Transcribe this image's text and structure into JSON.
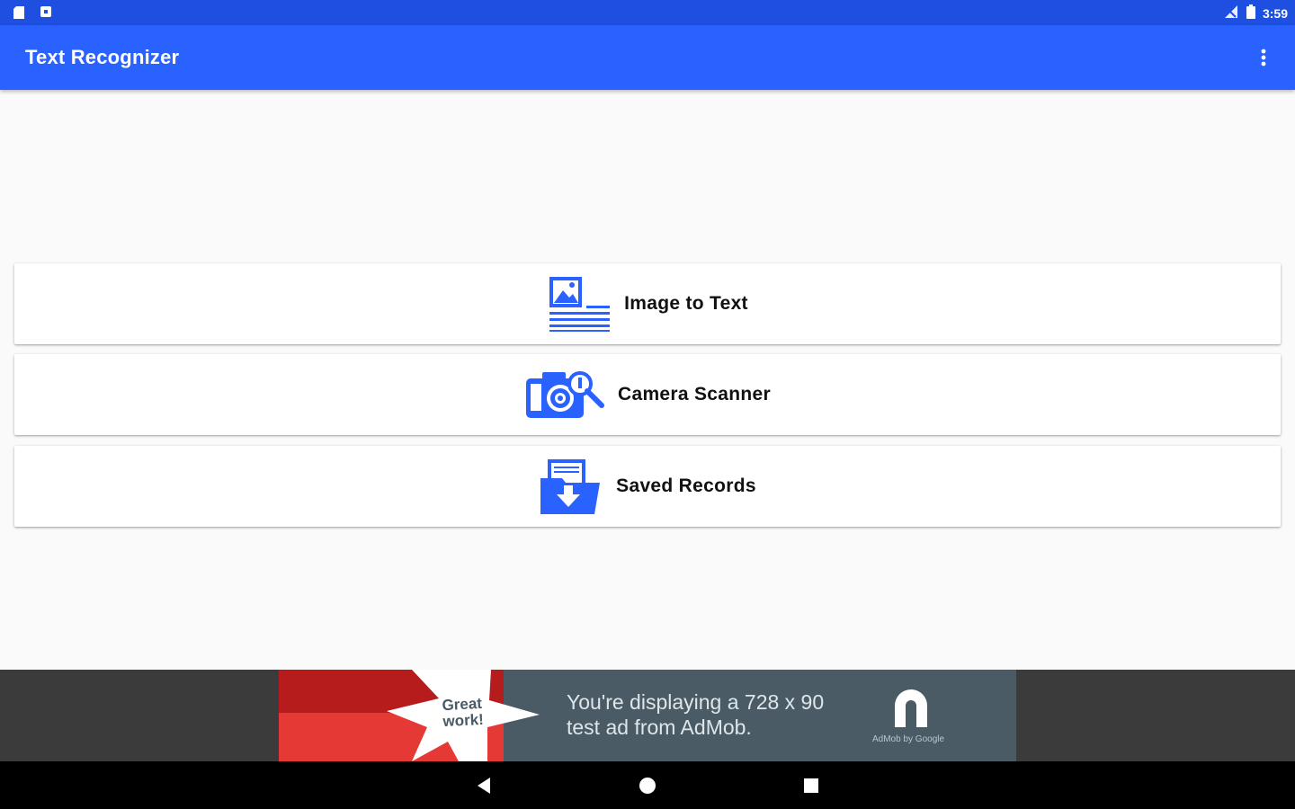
{
  "status_bar": {
    "time": "3:59",
    "icons": [
      "sd-card-icon",
      "notification-icon",
      "signal-icon",
      "battery-icon"
    ]
  },
  "app_bar": {
    "title": "Text Recognizer",
    "menu_icon": "overflow-menu-icon"
  },
  "menu": {
    "items": [
      {
        "label": "Image to Text",
        "icon": "image-text-icon"
      },
      {
        "label": "Camera Scanner",
        "icon": "camera-scanner-icon"
      },
      {
        "label": "Saved Records",
        "icon": "saved-records-icon"
      }
    ]
  },
  "ad": {
    "badge_line1": "Great",
    "badge_line2": "work!",
    "text_line1": "You're displaying a 728 x 90",
    "text_line2": "test ad from AdMob.",
    "brand": "AdMob by Google",
    "colors": {
      "background": "#4a5b66",
      "red": "#e53935",
      "dark_red": "#b71c1c"
    }
  },
  "nav_bar": {
    "buttons": [
      "back-icon",
      "home-icon",
      "recents-icon"
    ]
  },
  "colors": {
    "primary": "#2962ff",
    "primary_dark": "#1f4fe0",
    "icon_blue": "#2962ff"
  }
}
